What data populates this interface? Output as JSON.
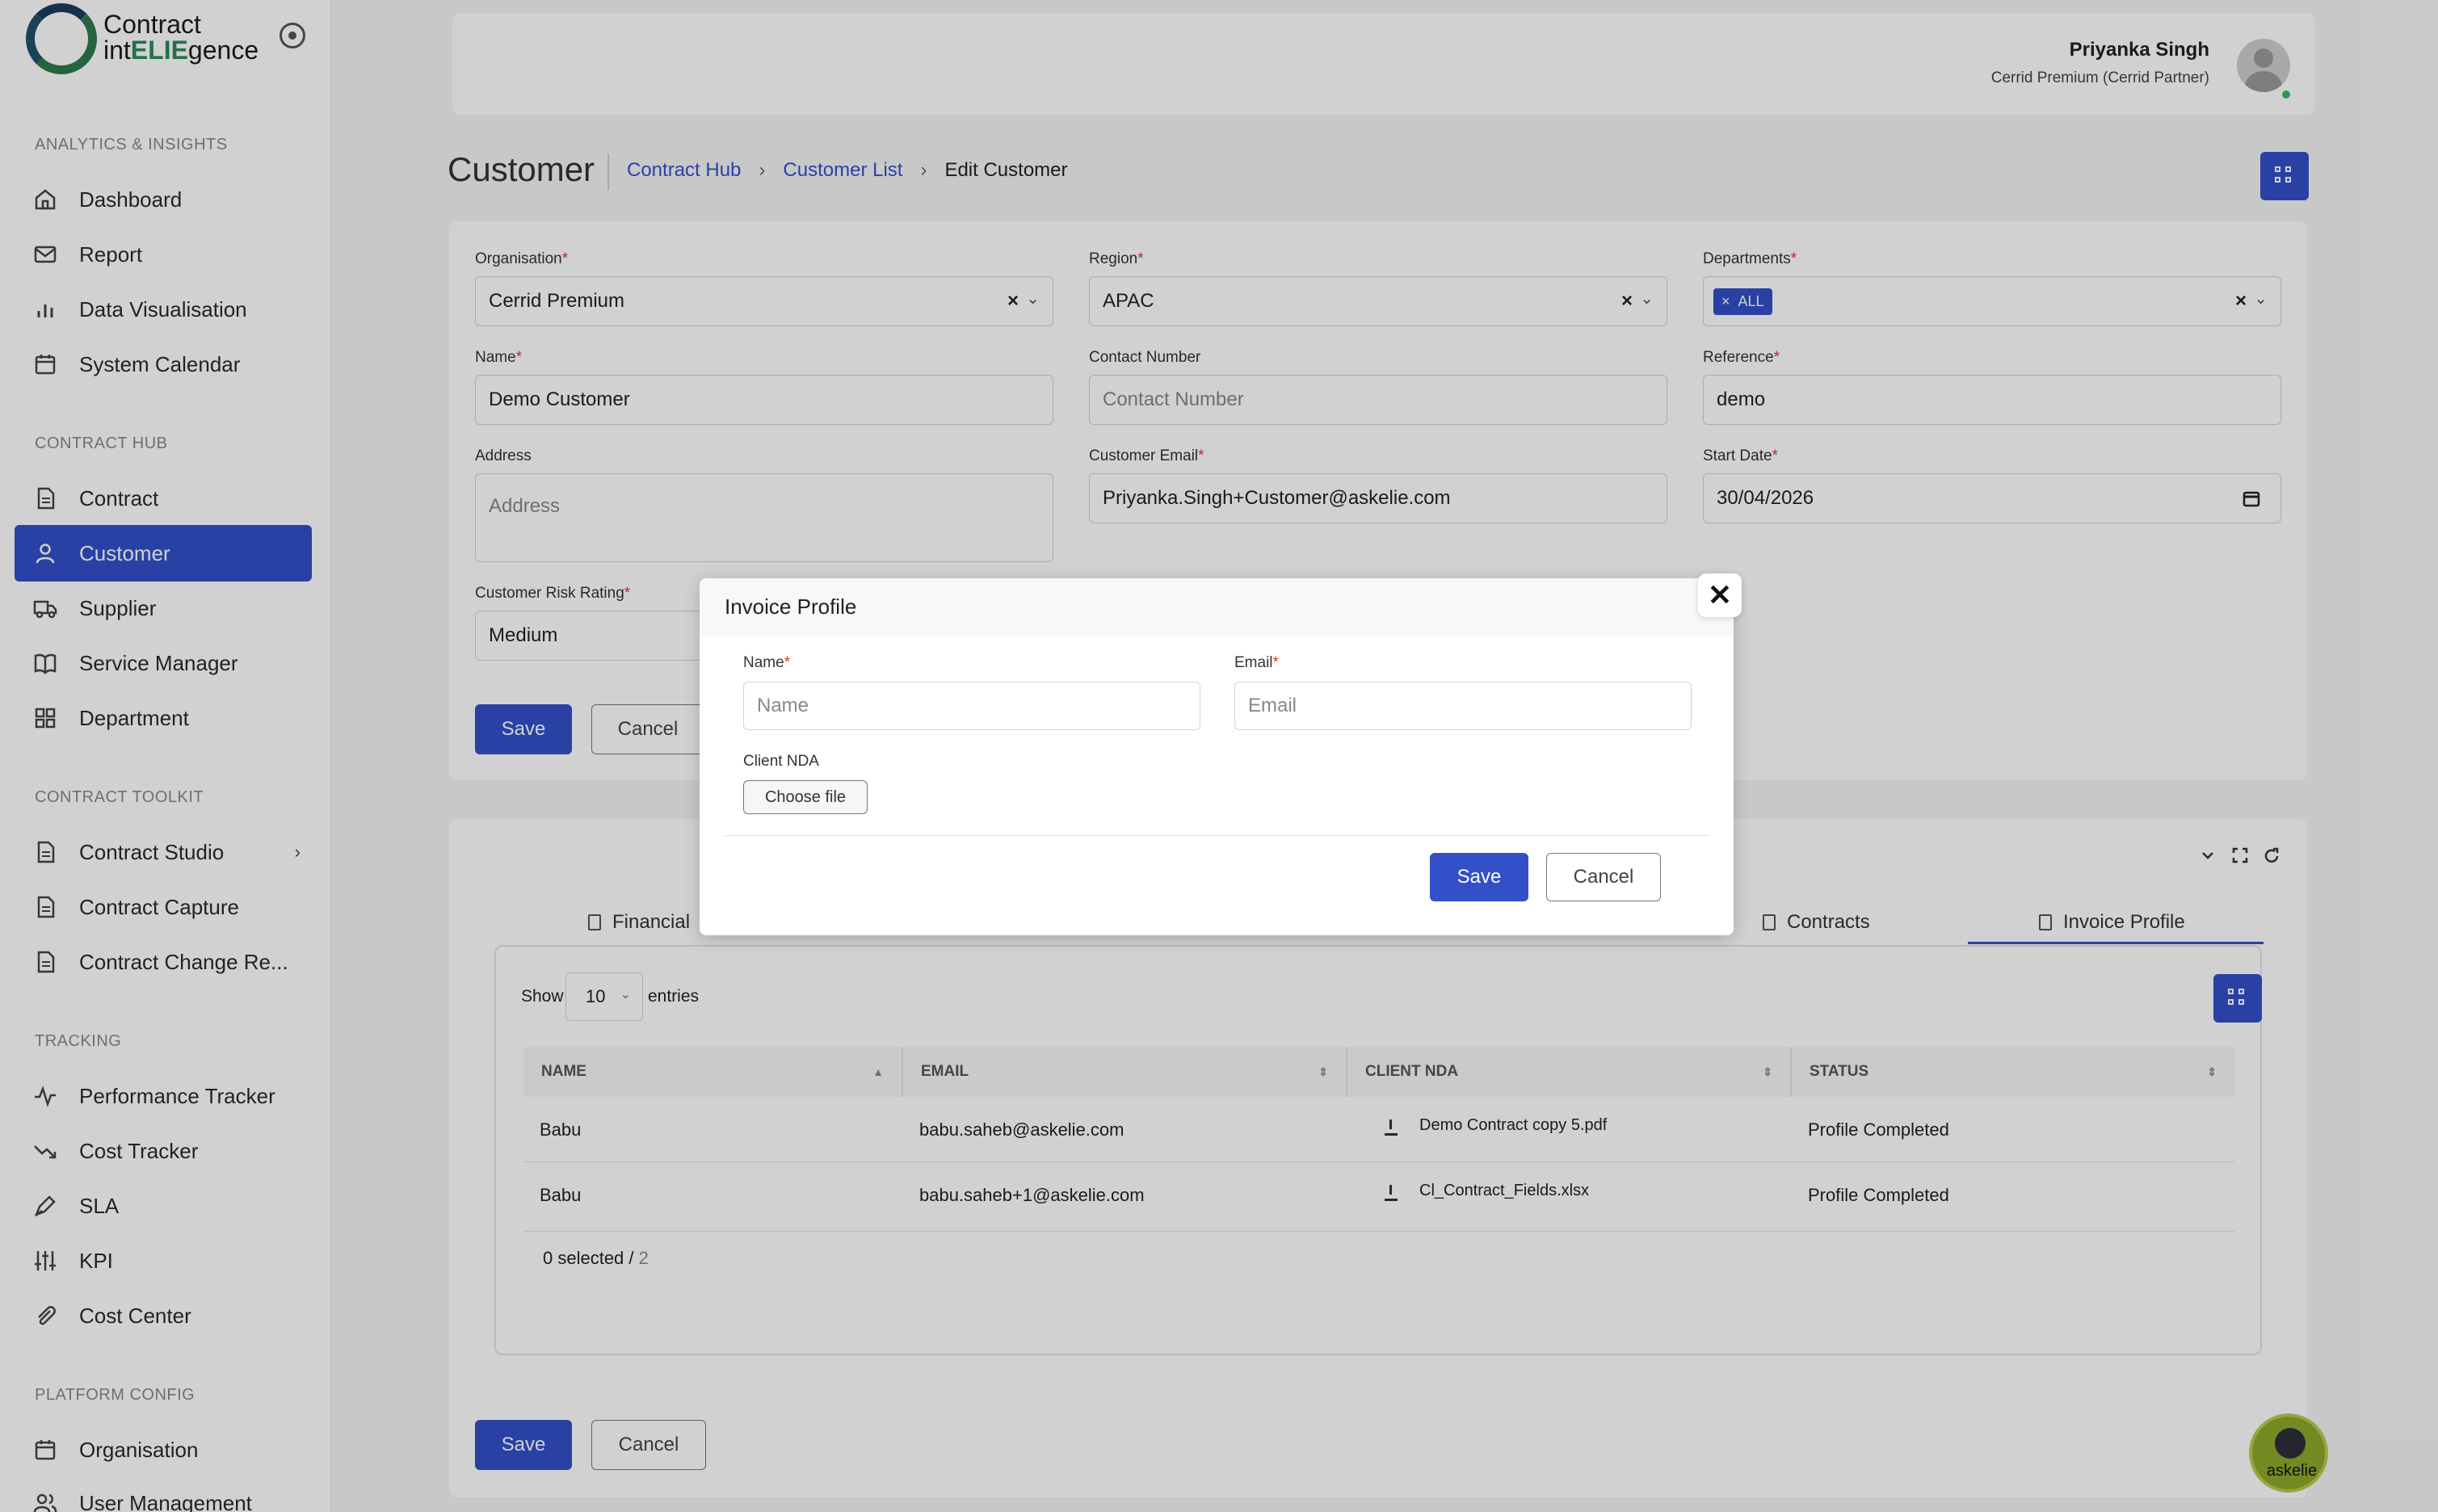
{
  "app": {
    "logo_line1": "Contract",
    "logo_line2_pre": "int",
    "logo_line2_mid": "ELIE",
    "logo_line2_post": "gence"
  },
  "sidebar": {
    "sections": [
      {
        "title": "ANALYTICS & INSIGHTS",
        "items": [
          {
            "label": "Dashboard",
            "icon": "home-icon"
          },
          {
            "label": "Report",
            "icon": "mail-icon"
          },
          {
            "label": "Data Visualisation",
            "icon": "bar-chart-icon"
          },
          {
            "label": "System Calendar",
            "icon": "calendar-icon"
          }
        ]
      },
      {
        "title": "CONTRACT HUB",
        "items": [
          {
            "label": "Contract",
            "icon": "document-icon"
          },
          {
            "label": "Customer",
            "icon": "user-icon",
            "active": true
          },
          {
            "label": "Supplier",
            "icon": "truck-icon"
          },
          {
            "label": "Service Manager",
            "icon": "book-icon"
          },
          {
            "label": "Department",
            "icon": "grid-icon"
          }
        ]
      },
      {
        "title": "CONTRACT TOOLKIT",
        "items": [
          {
            "label": "Contract Studio",
            "icon": "document-icon"
          },
          {
            "label": "Contract Capture",
            "icon": "document-icon"
          },
          {
            "label": "Contract Change Re...",
            "icon": "document-icon"
          }
        ]
      },
      {
        "title": "TRACKING",
        "items": [
          {
            "label": "Performance Tracker",
            "icon": "pulse-icon"
          },
          {
            "label": "Cost Tracker",
            "icon": "trend-down-icon"
          },
          {
            "label": "SLA",
            "icon": "pen-icon"
          },
          {
            "label": "KPI",
            "icon": "sliders-icon"
          },
          {
            "label": "Cost Center",
            "icon": "paperclip-icon"
          }
        ]
      },
      {
        "title": "PLATFORM CONFIG",
        "items": [
          {
            "label": "Organisation",
            "icon": "calendar-icon"
          },
          {
            "label": "User Management",
            "icon": "users-icon"
          }
        ]
      }
    ]
  },
  "header": {
    "user_name": "Priyanka Singh",
    "user_role": "Cerrid Premium (Cerrid Partner)"
  },
  "page": {
    "title": "Customer",
    "breadcrumb": [
      "Contract Hub",
      "Customer List",
      "Edit Customer"
    ]
  },
  "form": {
    "organisation": {
      "label": "Organisation",
      "value": "Cerrid Premium"
    },
    "region": {
      "label": "Region",
      "value": "APAC"
    },
    "departments": {
      "label": "Departments",
      "tag": "ALL"
    },
    "name": {
      "label": "Name",
      "value": "Demo Customer"
    },
    "contact": {
      "label": "Contact Number",
      "placeholder": "Contact Number"
    },
    "reference": {
      "label": "Reference",
      "value": "demo"
    },
    "address": {
      "label": "Address",
      "placeholder": "Address"
    },
    "email": {
      "label": "Customer Email",
      "value": "Priyanka.Singh+Customer@askelie.com"
    },
    "start_date": {
      "label": "Start Date",
      "value": "30/04/2026"
    },
    "risk": {
      "label": "Customer Risk Rating",
      "value": "Medium"
    },
    "save": "Save",
    "cancel": "Cancel",
    "req": "*"
  },
  "tabs": {
    "financial": "Financial",
    "contracts": "Contracts",
    "invoice_profile": "Invoice Profile"
  },
  "table": {
    "show": "Show",
    "page_size": "10",
    "entries": "entries",
    "columns": [
      "NAME",
      "EMAIL",
      "CLIENT NDA",
      "STATUS"
    ],
    "rows": [
      {
        "name": "Babu",
        "email": "babu.saheb@askelie.com",
        "nda": "Demo Contract copy 5.pdf",
        "status": "Profile Completed"
      },
      {
        "name": "Babu",
        "email": "babu.saheb+1@askelie.com",
        "nda": "Cl_Contract_Fields.xlsx",
        "status": "Profile Completed"
      }
    ],
    "selected": "0 selected / ",
    "total": "2"
  },
  "bottom": {
    "save": "Save",
    "cancel": "Cancel"
  },
  "modal": {
    "title": "Invoice Profile",
    "name_label": "Name",
    "name_placeholder": "Name",
    "email_label": "Email",
    "email_placeholder": "Email",
    "nda_label": "Client NDA",
    "choose_file": "Choose file",
    "save": "Save",
    "cancel": "Cancel",
    "close": "✕"
  },
  "assistant": {
    "label": "askelie"
  },
  "colors": {
    "primary": "#3350c8",
    "required": "#d33333",
    "online": "#2bbf5a"
  }
}
